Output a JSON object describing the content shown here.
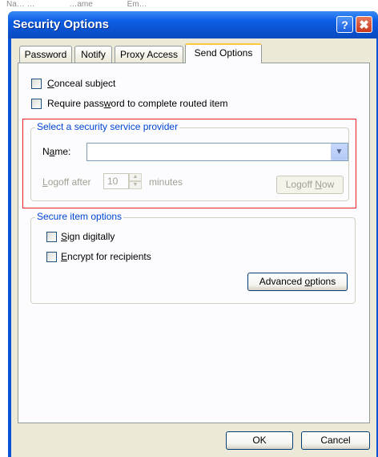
{
  "background_window": {
    "fragments": [
      "Na… …",
      "…ame",
      "Em…"
    ]
  },
  "dialog": {
    "title": "Security Options",
    "help_button": "?",
    "close_button": "✖",
    "tabs": [
      {
        "label": "Password",
        "active": false
      },
      {
        "label": "Notify",
        "active": false
      },
      {
        "label": "Proxy Access",
        "active": false
      },
      {
        "label": "Send Options",
        "active": true
      }
    ]
  },
  "send_options": {
    "conceal_subject": {
      "prefix": "",
      "accel": "C",
      "suffix": "onceal subject",
      "checked": false
    },
    "require_password": {
      "prefix": "Require pass",
      "accel": "w",
      "suffix": "ord to complete routed item",
      "checked": false
    },
    "provider_group": {
      "legend": "Select a security service provider",
      "name_label_prefix": "N",
      "name_label_accel": "a",
      "name_label_suffix": "me:",
      "name_value": "",
      "dropdown_arrow": "▼",
      "logoff_prefix": "",
      "logoff_accel": "L",
      "logoff_suffix": "ogoff after",
      "logoff_minutes_value": "10",
      "minutes_label": "minutes",
      "spin_up": "▲",
      "spin_down": "▼",
      "logoff_now_prefix": "Logoff ",
      "logoff_now_accel": "N",
      "logoff_now_suffix": "ow"
    },
    "secure_group": {
      "legend": "Secure item options",
      "sign_digitally": {
        "prefix": "",
        "accel": "S",
        "suffix": "ign digitally",
        "checked": false
      },
      "encrypt": {
        "prefix": "",
        "accel": "E",
        "suffix": "ncrypt for recipients",
        "checked": false
      },
      "advanced_prefix": "Advanced ",
      "advanced_accel": "o",
      "advanced_suffix": "ptions"
    }
  },
  "footer": {
    "ok_label": "OK",
    "cancel_label": "Cancel"
  },
  "colors": {
    "title_bar": "#0a52d1",
    "client_bg": "#ece9d8",
    "group_legend": "#0046d5",
    "highlight_box": "#e8202a",
    "active_tab_accent": "#ffc83c"
  }
}
